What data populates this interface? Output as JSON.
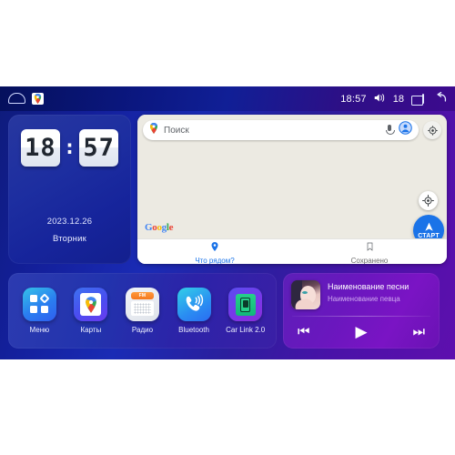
{
  "statusbar": {
    "home_icon": "home-icon",
    "app_badge_icon": "google-maps-badge-icon",
    "time": "18:57",
    "volume_icon": "volume-icon",
    "volume_level": "18",
    "recents_icon": "recents-icon",
    "back_icon": "back-arrow-icon"
  },
  "clock_widget": {
    "hours": "18",
    "separator": ":",
    "minutes": "57",
    "date": "2023.12.26",
    "weekday": "Вторник"
  },
  "map_widget": {
    "search_placeholder": "Поиск",
    "pin_icon": "google-maps-pin-icon",
    "mic_icon": "microphone-icon",
    "avatar_icon": "account-avatar-icon",
    "settings_icon": "settings-gear-icon",
    "google_logo": {
      "l1": "G",
      "l2": "o",
      "l3": "o",
      "l4": "g",
      "l5": "l",
      "l6": "e"
    },
    "compass_icon": "compass-icon",
    "start_button_label": "СТАРТ",
    "tabs": [
      {
        "label": "Что рядом?",
        "icon": "location-pin-icon",
        "active": true
      },
      {
        "label": "Сохранено",
        "icon": "bookmark-icon",
        "active": false
      }
    ]
  },
  "apps": [
    {
      "label": "Меню",
      "icon": "menu-grid-icon"
    },
    {
      "label": "Карты",
      "icon": "maps-icon"
    },
    {
      "label": "Радио",
      "icon": "radio-icon",
      "display": "FM"
    },
    {
      "label": "Bluetooth",
      "icon": "bluetooth-phone-icon"
    },
    {
      "label": "Car Link 2.0",
      "icon": "car-link-icon"
    }
  ],
  "music_widget": {
    "album_art_icon": "album-art",
    "title": "Наименование песни",
    "artist": "Наименование певца",
    "prev_icon": "previous-track-icon",
    "play_icon": "play-icon",
    "next_icon": "next-track-icon",
    "prev_glyph": "⏮",
    "play_glyph": "▶",
    "next_glyph": "⏭"
  },
  "colors": {
    "bg_blue": "#1a2bb5",
    "bg_purple": "#5e0fae",
    "accent_blue": "#1a73e8",
    "map_bg": "#eceae2",
    "music_purple": "#7a14c4"
  }
}
